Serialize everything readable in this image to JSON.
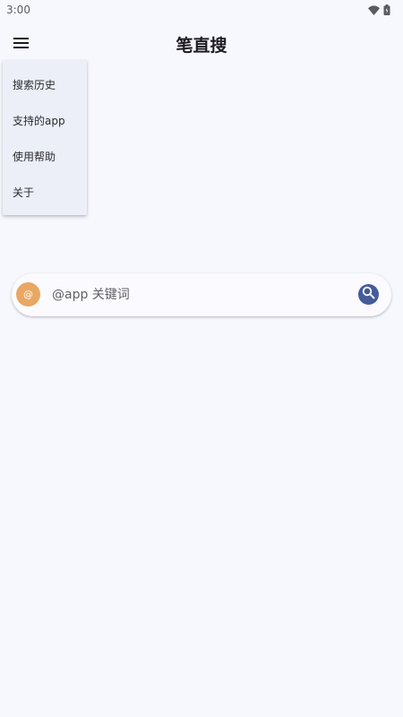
{
  "status_bar": {
    "time": "3:00",
    "icons": [
      "wifi-icon",
      "battery-icon"
    ]
  },
  "app_bar": {
    "title": "笔直搜",
    "menu_icon": "hamburger-menu-icon"
  },
  "menu": {
    "items": [
      {
        "label": "搜索历史"
      },
      {
        "label": "支持的app"
      },
      {
        "label": "使用帮助"
      },
      {
        "label": "关于"
      }
    ]
  },
  "search": {
    "app_icon_glyph": "@",
    "placeholder": "@app 关键词",
    "value": "",
    "search_icon": "magnifier-icon"
  },
  "colors": {
    "background": "#f7f8fe",
    "menu_background": "#eceff7",
    "app_avatar": "#e9a762",
    "search_button": "#455b9a"
  }
}
